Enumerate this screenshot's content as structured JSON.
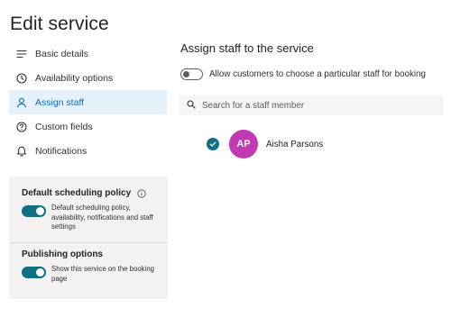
{
  "page": {
    "title": "Edit service"
  },
  "nav": {
    "items": [
      {
        "label": "Basic details",
        "icon": "lines-icon"
      },
      {
        "label": "Availability options",
        "icon": "clock-icon"
      },
      {
        "label": "Assign staff",
        "icon": "person-icon",
        "active": true
      },
      {
        "label": "Custom fields",
        "icon": "question-icon"
      },
      {
        "label": "Notifications",
        "icon": "bell-icon"
      }
    ]
  },
  "settings": {
    "scheduling": {
      "title": "Default scheduling policy",
      "toggle_on": true,
      "toggle_text": "Default scheduling policy, availability, notifications and staff settings"
    },
    "publishing": {
      "title": "Publishing options",
      "toggle_on": true,
      "toggle_text": "Show this service on the booking page"
    }
  },
  "main": {
    "heading": "Assign staff to the service",
    "allow_toggle": {
      "on": false,
      "label": "Allow customers to choose a particular staff for booking"
    },
    "search": {
      "placeholder": "Search for a staff member",
      "value": ""
    },
    "staff": [
      {
        "initials": "AP",
        "name": "Aisha Parsons",
        "selected": true
      }
    ]
  },
  "colors": {
    "accent": "#0f6f84",
    "active_bg": "#e5f1fb",
    "active_text": "#0f6cbd",
    "avatar_bg": "#c239b3"
  }
}
